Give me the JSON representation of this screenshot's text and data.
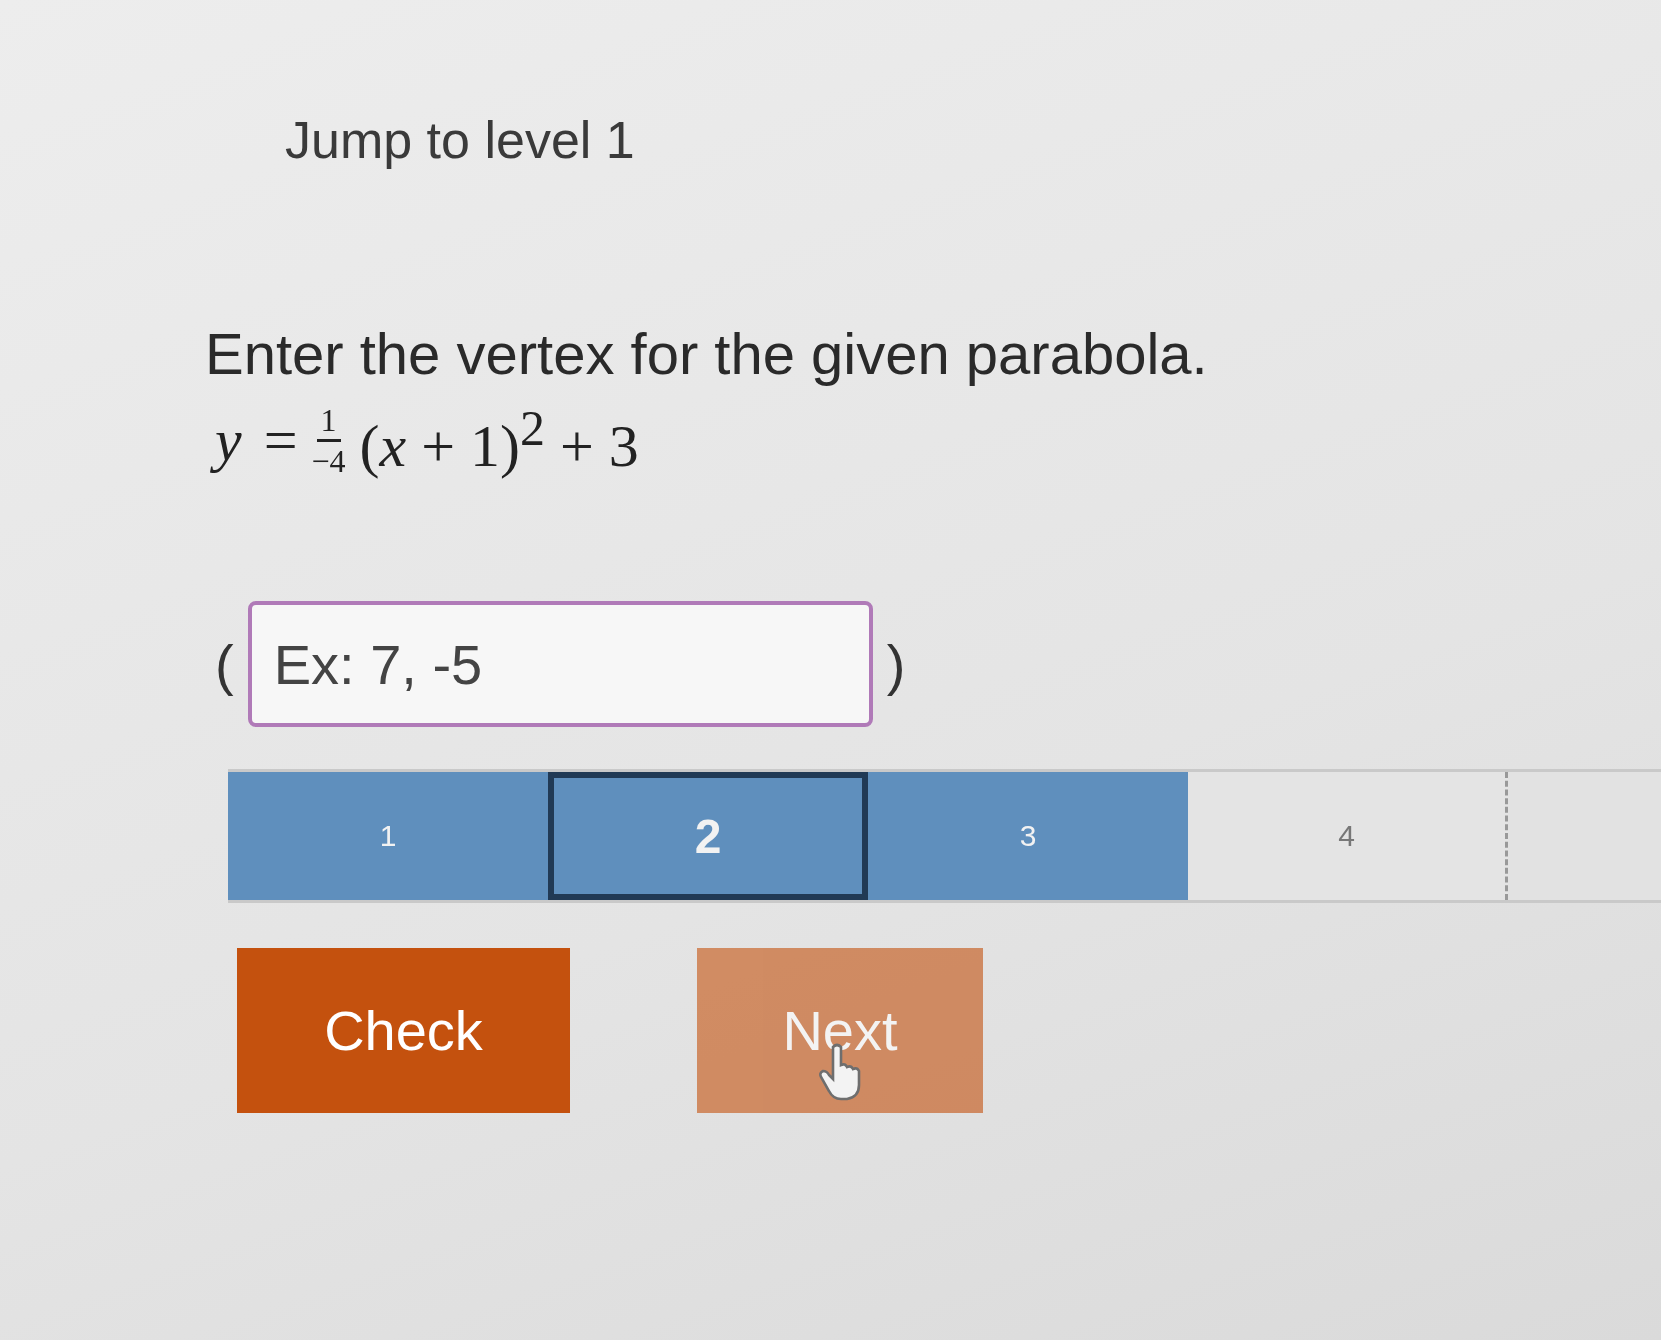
{
  "header": {
    "title": "Jump to level 1"
  },
  "question": {
    "prompt": "Enter the vertex for the given parabola.",
    "equation": {
      "lhs": "y",
      "equals": "=",
      "numerator": "1",
      "denominator": "−4",
      "body": "(*x* + 1)$^{2}$ + 3"
    }
  },
  "answer": {
    "open_paren": "(",
    "close_paren": ")",
    "placeholder": "Ex: 7, -5",
    "focused": true
  },
  "levels": [
    {
      "label": "1",
      "completed": true,
      "selected": false
    },
    {
      "label": "2",
      "completed": true,
      "selected": true
    },
    {
      "label": "3",
      "completed": true,
      "selected": false
    },
    {
      "label": "4",
      "completed": false,
      "selected": false
    }
  ],
  "buttons": [
    {
      "kind": "primary",
      "label": "Check",
      "disabled": false
    },
    {
      "kind": "primary",
      "label": "Next",
      "disabled": true
    }
  ]
}
